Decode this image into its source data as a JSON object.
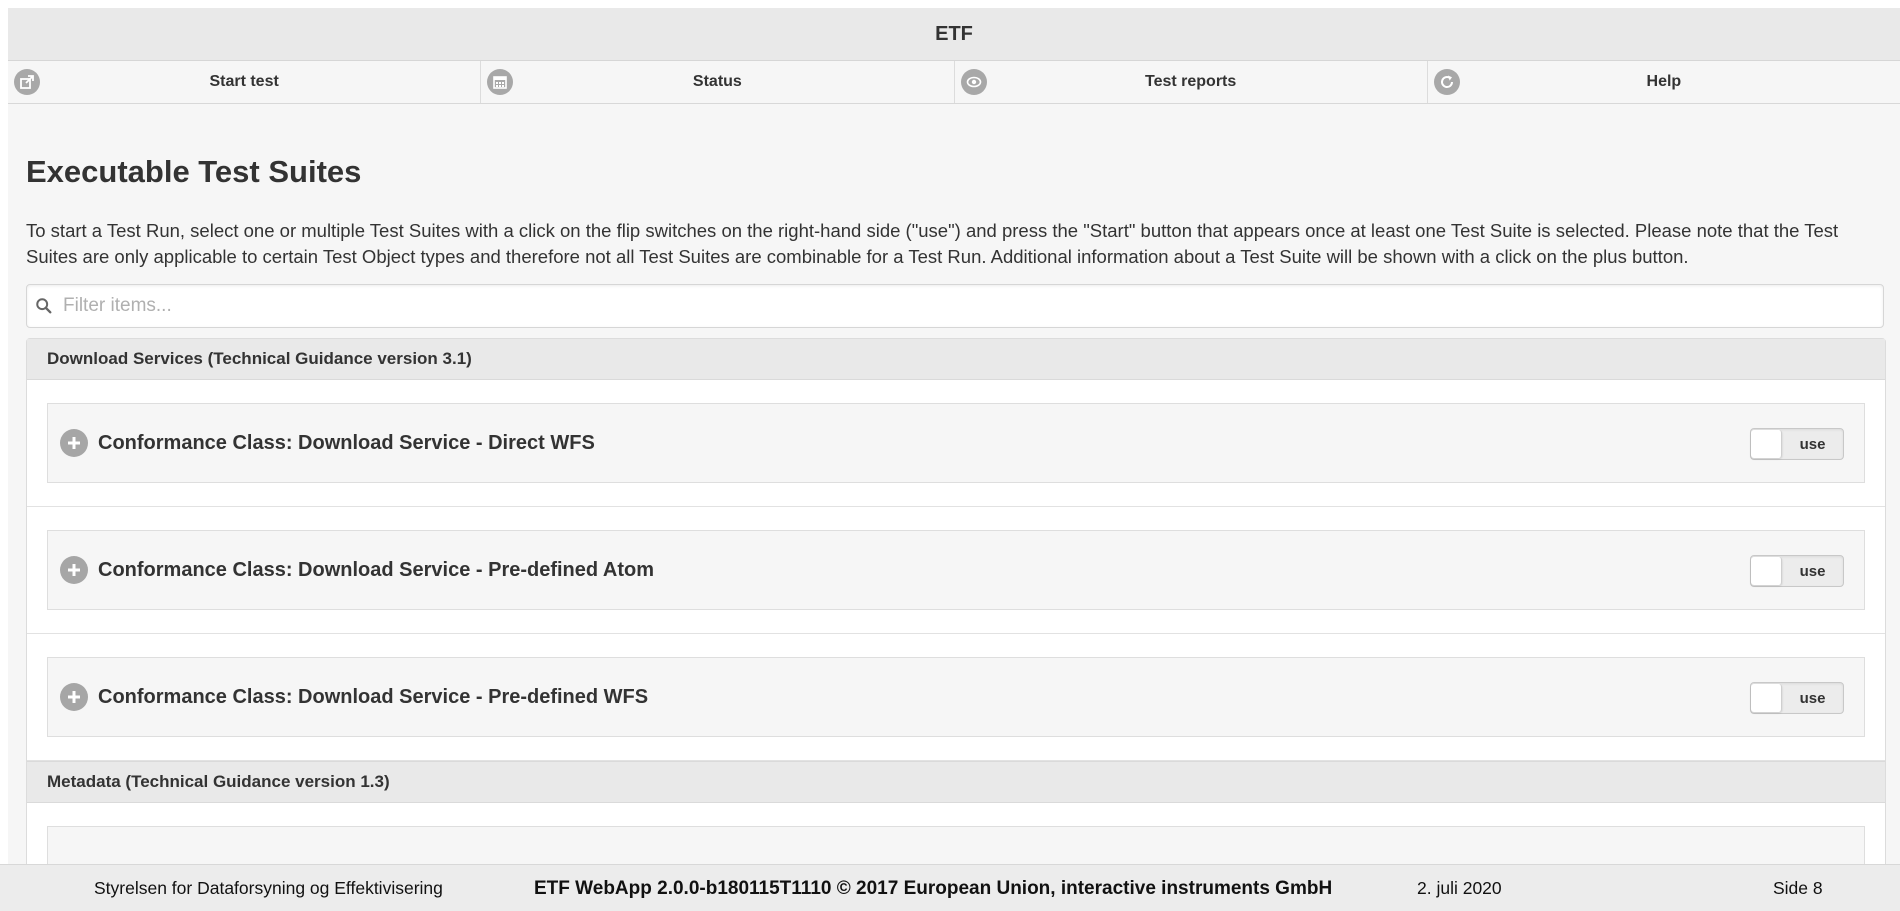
{
  "app": {
    "title": "ETF"
  },
  "nav": [
    {
      "label": "Start test",
      "icon": "external-link-icon"
    },
    {
      "label": "Status",
      "icon": "calendar-icon"
    },
    {
      "label": "Test reports",
      "icon": "eye-icon"
    },
    {
      "label": "Help",
      "icon": "refresh-icon"
    }
  ],
  "page": {
    "title": "Executable Test Suites",
    "intro": "To start a Test Run, select one or multiple Test Suites with a click on the flip switches on the right-hand side (\"use\") and press the \"Start\" button that appears once at least one Test Suite is selected. Please note that the Test Suites are only applicable to certain Test Object types and therefore not all Test Suites are combinable for a Test Run. Additional information about a Test Suite will be shown with a click on the plus button."
  },
  "filter": {
    "placeholder": "Filter items...",
    "value": ""
  },
  "groups": [
    {
      "title": "Download Services (Technical Guidance version 3.1)",
      "suites": [
        {
          "label": "Conformance Class: Download Service - Direct WFS",
          "toggle": "use"
        },
        {
          "label": "Conformance Class: Download Service - Pre-defined Atom",
          "toggle": "use"
        },
        {
          "label": "Conformance Class: Download Service - Pre-defined WFS",
          "toggle": "use"
        }
      ]
    },
    {
      "title": "Metadata (Technical Guidance version 1.3)",
      "suites": []
    }
  ],
  "footer": {
    "organization": "Styrelsen for Dataforsyning og Effektivisering",
    "app_info": "ETF WebApp 2.0.0-b180115T1110 © 2017 European Union, interactive instruments GmbH",
    "date": "2. juli 2020",
    "page": "Side 8"
  },
  "colors": {
    "header_bg": "#e9e9e9",
    "body_bg": "#f6f6f6",
    "icon_gray": "#a8a8a8",
    "text": "#333333"
  }
}
